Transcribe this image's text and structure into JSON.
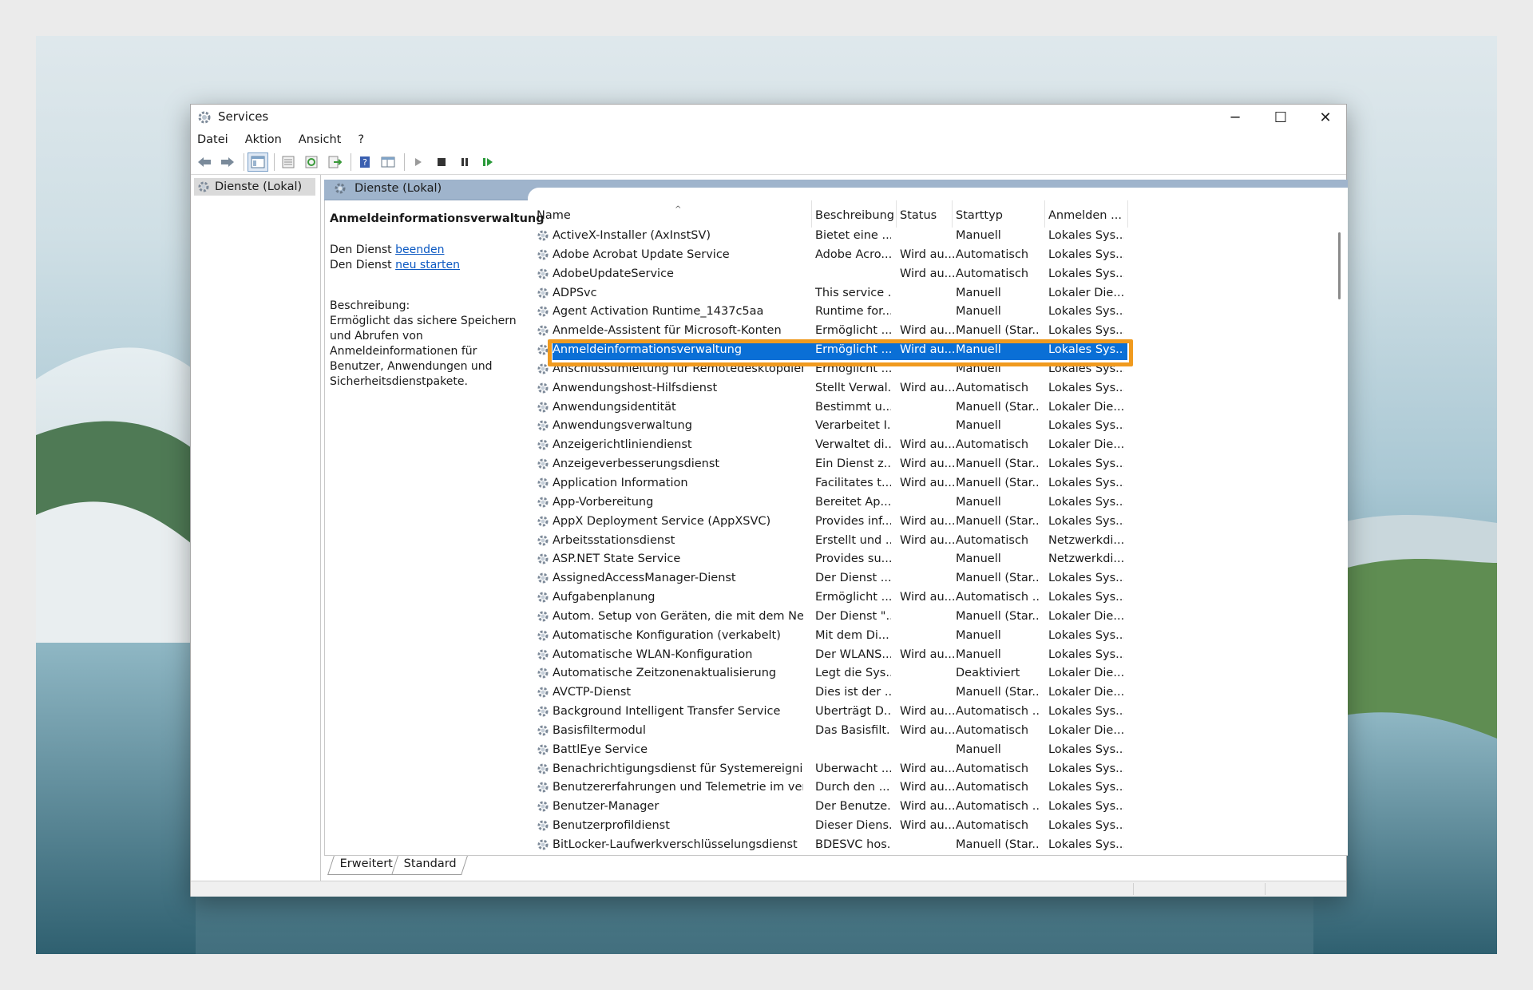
{
  "window": {
    "title": "Services",
    "min_glyph": "─",
    "max_glyph": "☐",
    "close_glyph": "✕"
  },
  "menu": [
    "Datei",
    "Aktion",
    "Ansicht",
    "?"
  ],
  "toolbar": {
    "icons": [
      "back-arrow-icon",
      "forward-arrow-icon",
      "console-tree-icon",
      "properties-icon",
      "refresh-icon",
      "export-icon",
      "help-icon",
      "view-icon",
      "play-icon",
      "stop-icon",
      "pause-icon",
      "resume-icon"
    ]
  },
  "tree": {
    "root": "Dienste (Lokal)"
  },
  "panel": {
    "header": "Dienste (Lokal)",
    "detail": {
      "title": "Anmeldeinformationsverwaltung",
      "line1_prefix": "Den Dienst ",
      "line1_link": "beenden",
      "line2_prefix": "Den Dienst ",
      "line2_link": "neu starten",
      "desc_label": "Beschreibung:",
      "desc": "Ermöglicht das sichere Speichern und Abrufen von Anmeldeinformationen für Benutzer, Anwendungen und Sicherheitsdienstpakete."
    },
    "columns": [
      "Name",
      "Beschreibung",
      "Status",
      "Starttyp",
      "Anmelden ..."
    ],
    "selected_index": 6,
    "rows": [
      {
        "name": "ActiveX-Installer (AxInstSV)",
        "desc": "Bietet eine ...",
        "status": "",
        "start": "Manuell",
        "logon": "Lokales Sys..."
      },
      {
        "name": "Adobe Acrobat Update Service",
        "desc": "Adobe Acro...",
        "status": "Wird au...",
        "start": "Automatisch",
        "logon": "Lokales Sys..."
      },
      {
        "name": "AdobeUpdateService",
        "desc": "",
        "status": "Wird au...",
        "start": "Automatisch",
        "logon": "Lokales Sys..."
      },
      {
        "name": "ADPSvc",
        "desc": "This service ...",
        "status": "",
        "start": "Manuell",
        "logon": "Lokaler Die..."
      },
      {
        "name": "Agent Activation Runtime_1437c5aa",
        "desc": "Runtime for...",
        "status": "",
        "start": "Manuell",
        "logon": "Lokales Sys..."
      },
      {
        "name": "Anmelde-Assistent für Microsoft-Konten",
        "desc": "Ermöglicht ...",
        "status": "Wird au...",
        "start": "Manuell (Star...",
        "logon": "Lokales Sys..."
      },
      {
        "name": "Anmeldeinformationsverwaltung",
        "desc": "Ermöglicht ...",
        "status": "Wird au...",
        "start": "Manuell",
        "logon": "Lokales Sys..."
      },
      {
        "name": "Anschlussumleitung für Remotedesktopdien...",
        "desc": "Ermöglicht ...",
        "status": "",
        "start": "Manuell",
        "logon": "Lokales Sys..."
      },
      {
        "name": "Anwendungshost-Hilfsdienst",
        "desc": "Stellt Verwal...",
        "status": "Wird au...",
        "start": "Automatisch",
        "logon": "Lokales Sys..."
      },
      {
        "name": "Anwendungsidentität",
        "desc": "Bestimmt u...",
        "status": "",
        "start": "Manuell (Star...",
        "logon": "Lokaler Die..."
      },
      {
        "name": "Anwendungsverwaltung",
        "desc": "Verarbeitet I...",
        "status": "",
        "start": "Manuell",
        "logon": "Lokales Sys..."
      },
      {
        "name": "Anzeigerichtliniendienst",
        "desc": "Verwaltet di...",
        "status": "Wird au...",
        "start": "Automatisch",
        "logon": "Lokaler Die..."
      },
      {
        "name": "Anzeigeverbesserungsdienst",
        "desc": "Ein Dienst z...",
        "status": "Wird au...",
        "start": "Manuell (Star...",
        "logon": "Lokales Sys..."
      },
      {
        "name": "Application Information",
        "desc": "Facilitates t...",
        "status": "Wird au...",
        "start": "Manuell (Star...",
        "logon": "Lokales Sys..."
      },
      {
        "name": "App-Vorbereitung",
        "desc": "Bereitet Ap...",
        "status": "",
        "start": "Manuell",
        "logon": "Lokales Sys..."
      },
      {
        "name": "AppX Deployment Service (AppXSVC)",
        "desc": "Provides inf...",
        "status": "Wird au...",
        "start": "Manuell (Star...",
        "logon": "Lokales Sys..."
      },
      {
        "name": "Arbeitsstationsdienst",
        "desc": "Erstellt und ...",
        "status": "Wird au...",
        "start": "Automatisch",
        "logon": "Netzwerkdi..."
      },
      {
        "name": "ASP.NET State Service",
        "desc": "Provides su...",
        "status": "",
        "start": "Manuell",
        "logon": "Netzwerkdi..."
      },
      {
        "name": "AssignedAccessManager-Dienst",
        "desc": "Der Dienst ...",
        "status": "",
        "start": "Manuell (Star...",
        "logon": "Lokales Sys..."
      },
      {
        "name": "Aufgabenplanung",
        "desc": "Ermöglicht ...",
        "status": "Wird au...",
        "start": "Automatisch ...",
        "logon": "Lokales Sys..."
      },
      {
        "name": "Autom. Setup von Geräten, die mit dem Netz...",
        "desc": "Der Dienst \"...",
        "status": "",
        "start": "Manuell (Star...",
        "logon": "Lokaler Die..."
      },
      {
        "name": "Automatische Konfiguration (verkabelt)",
        "desc": "Mit dem Di...",
        "status": "",
        "start": "Manuell",
        "logon": "Lokales Sys..."
      },
      {
        "name": "Automatische WLAN-Konfiguration",
        "desc": "Der WLANS...",
        "status": "Wird au...",
        "start": "Manuell",
        "logon": "Lokales Sys..."
      },
      {
        "name": "Automatische Zeitzonenaktualisierung",
        "desc": "Legt die Sys...",
        "status": "",
        "start": "Deaktiviert",
        "logon": "Lokaler Die..."
      },
      {
        "name": "AVCTP-Dienst",
        "desc": "Dies ist der ...",
        "status": "",
        "start": "Manuell (Star...",
        "logon": "Lokaler Die..."
      },
      {
        "name": "Background Intelligent Transfer Service",
        "desc": "Überträgt D...",
        "status": "Wird au...",
        "start": "Automatisch ...",
        "logon": "Lokales Sys..."
      },
      {
        "name": "Basisfiltermodul",
        "desc": "Das Basisfilt...",
        "status": "Wird au...",
        "start": "Automatisch",
        "logon": "Lokaler Die..."
      },
      {
        "name": "BattlEye Service",
        "desc": "",
        "status": "",
        "start": "Manuell",
        "logon": "Lokales Sys..."
      },
      {
        "name": "Benachrichtigungsdienst für Systemereignisse",
        "desc": "Überwacht ...",
        "status": "Wird au...",
        "start": "Automatisch",
        "logon": "Lokales Sys..."
      },
      {
        "name": "Benutzererfahrungen und Telemetrie im verb...",
        "desc": "Durch den ...",
        "status": "Wird au...",
        "start": "Automatisch",
        "logon": "Lokales Sys..."
      },
      {
        "name": "Benutzer-Manager",
        "desc": "Der Benutze...",
        "status": "Wird au...",
        "start": "Automatisch ...",
        "logon": "Lokales Sys..."
      },
      {
        "name": "Benutzerprofildienst",
        "desc": "Dieser Diens...",
        "status": "Wird au...",
        "start": "Automatisch",
        "logon": "Lokales Sys..."
      },
      {
        "name": "BitLocker-Laufwerkverschlüsselungsdienst",
        "desc": "BDESVC hos...",
        "status": "",
        "start": "Manuell (Star...",
        "logon": "Lokales Sys..."
      }
    ],
    "tabs": [
      "Erweitert",
      "Standard"
    ]
  },
  "colors": {
    "selection": "#0a6fd6",
    "highlight_border": "#f09a1e",
    "link": "#0a58c2",
    "header_band": "#9fb4cc"
  }
}
